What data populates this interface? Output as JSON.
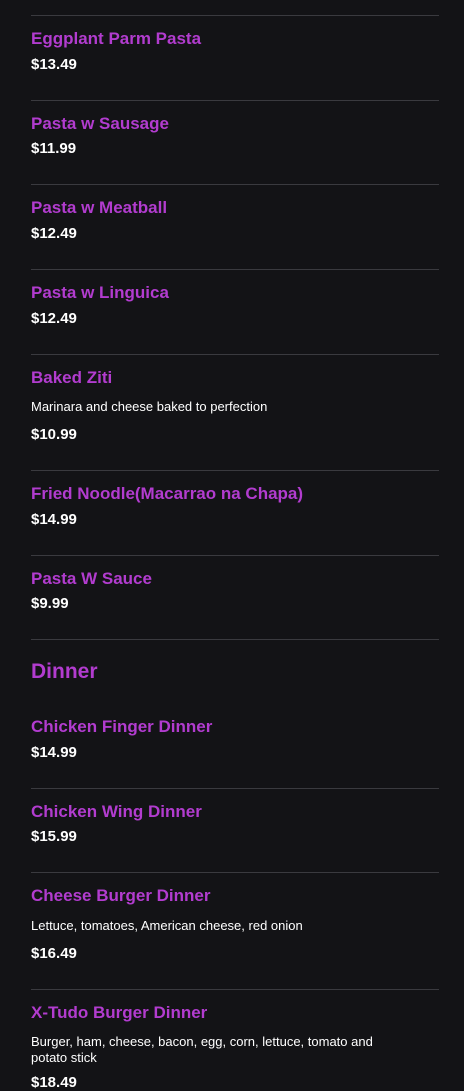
{
  "colors": {
    "background": "#131316",
    "accent": "#b23ccf",
    "text": "#ffffff",
    "divider": "#3a3a3f"
  },
  "sections": [
    {
      "title": "",
      "items": [
        {
          "name": "Eggplant Parm Pasta",
          "price": "$13.49"
        },
        {
          "name": "Pasta w Sausage",
          "price": "$11.99"
        },
        {
          "name": "Pasta w Meatball",
          "price": "$12.49"
        },
        {
          "name": "Pasta w Linguica",
          "price": "$12.49"
        },
        {
          "name": "Baked Ziti",
          "description": "Marinara and cheese baked to perfection",
          "price": "$10.99"
        },
        {
          "name": "Fried Noodle(Macarrao na Chapa)",
          "price": "$14.99"
        },
        {
          "name": "Pasta W Sauce",
          "price": "$9.99"
        }
      ]
    },
    {
      "title": "Dinner",
      "items": [
        {
          "name": "Chicken Finger Dinner",
          "price": "$14.99"
        },
        {
          "name": "Chicken Wing Dinner",
          "price": "$15.99"
        },
        {
          "name": "Cheese Burger Dinner",
          "description": "Lettuce, tomatoes, American cheese, red onion",
          "price": "$16.49"
        },
        {
          "name": "X-Tudo Burger Dinner",
          "description": "Burger, ham, cheese, bacon, egg, corn, lettuce, tomato and potato stick",
          "price": "$18.49"
        }
      ]
    }
  ]
}
